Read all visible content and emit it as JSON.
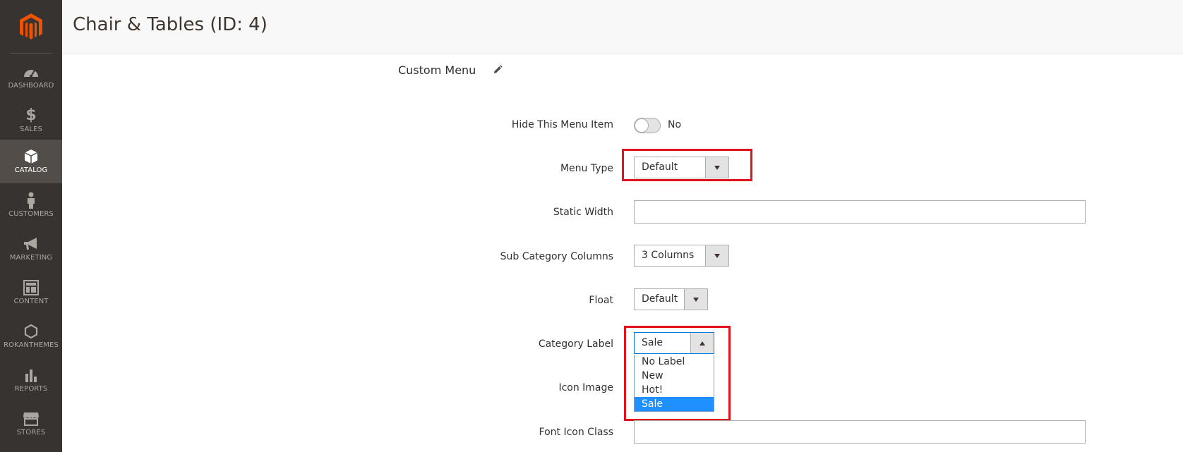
{
  "page": {
    "title": "Chair & Tables (ID: 4)"
  },
  "sidebar": {
    "items": [
      {
        "label": "DASHBOARD",
        "icon": "dashboard-icon"
      },
      {
        "label": "SALES",
        "icon": "dollar-icon"
      },
      {
        "label": "CATALOG",
        "icon": "box-icon",
        "active": true
      },
      {
        "label": "CUSTOMERS",
        "icon": "person-icon"
      },
      {
        "label": "MARKETING",
        "icon": "megaphone-icon"
      },
      {
        "label": "CONTENT",
        "icon": "layout-icon"
      },
      {
        "label": "ROKANTHEMES",
        "icon": "hexagon-icon"
      },
      {
        "label": "REPORTS",
        "icon": "bar-chart-icon"
      },
      {
        "label": "STORES",
        "icon": "store-icon"
      }
    ]
  },
  "section": {
    "title": "Custom Menu"
  },
  "fields": {
    "hide_menu_item": {
      "label": "Hide This Menu Item",
      "value": "No"
    },
    "menu_type": {
      "label": "Menu Type",
      "value": "Default"
    },
    "static_width": {
      "label": "Static Width",
      "value": ""
    },
    "sub_category_columns": {
      "label": "Sub Category Columns",
      "value": "3 Columns"
    },
    "float": {
      "label": "Float",
      "value": "Default"
    },
    "category_label": {
      "label": "Category Label",
      "value": "Sale",
      "options": [
        "No Label",
        "New",
        "Hot!",
        "Sale"
      ]
    },
    "icon_image": {
      "label": "Icon Image"
    },
    "font_icon_class": {
      "label": "Font Icon Class",
      "value": ""
    }
  },
  "colors": {
    "sidebar_bg": "#373330",
    "sidebar_active": "#524d49",
    "brand_orange": "#eb5202",
    "highlight_red": "#e0121b",
    "selected_option": "#1e90ff"
  }
}
